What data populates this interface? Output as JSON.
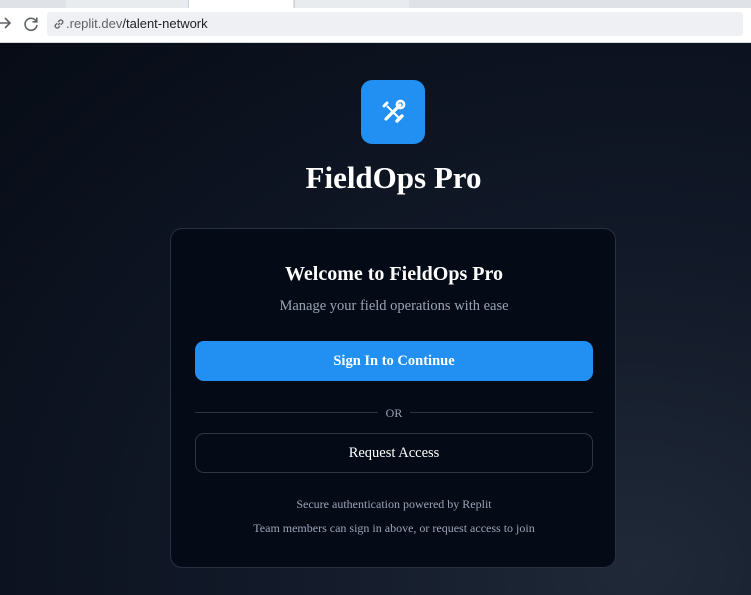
{
  "browser": {
    "url_host": ".replit.dev",
    "url_path": "/talent-network"
  },
  "app": {
    "title": "FieldOps Pro",
    "logo_icon": "wrench-screwdriver-icon",
    "accent_color": "#2290f2"
  },
  "card": {
    "heading": "Welcome to FieldOps Pro",
    "subtitle": "Manage your field operations with ease",
    "signin_label": "Sign In to Continue",
    "divider_label": "OR",
    "request_label": "Request Access",
    "footer_powered": "Secure authentication powered by Replit",
    "footer_help": "Team members can sign in above, or request access to join"
  }
}
